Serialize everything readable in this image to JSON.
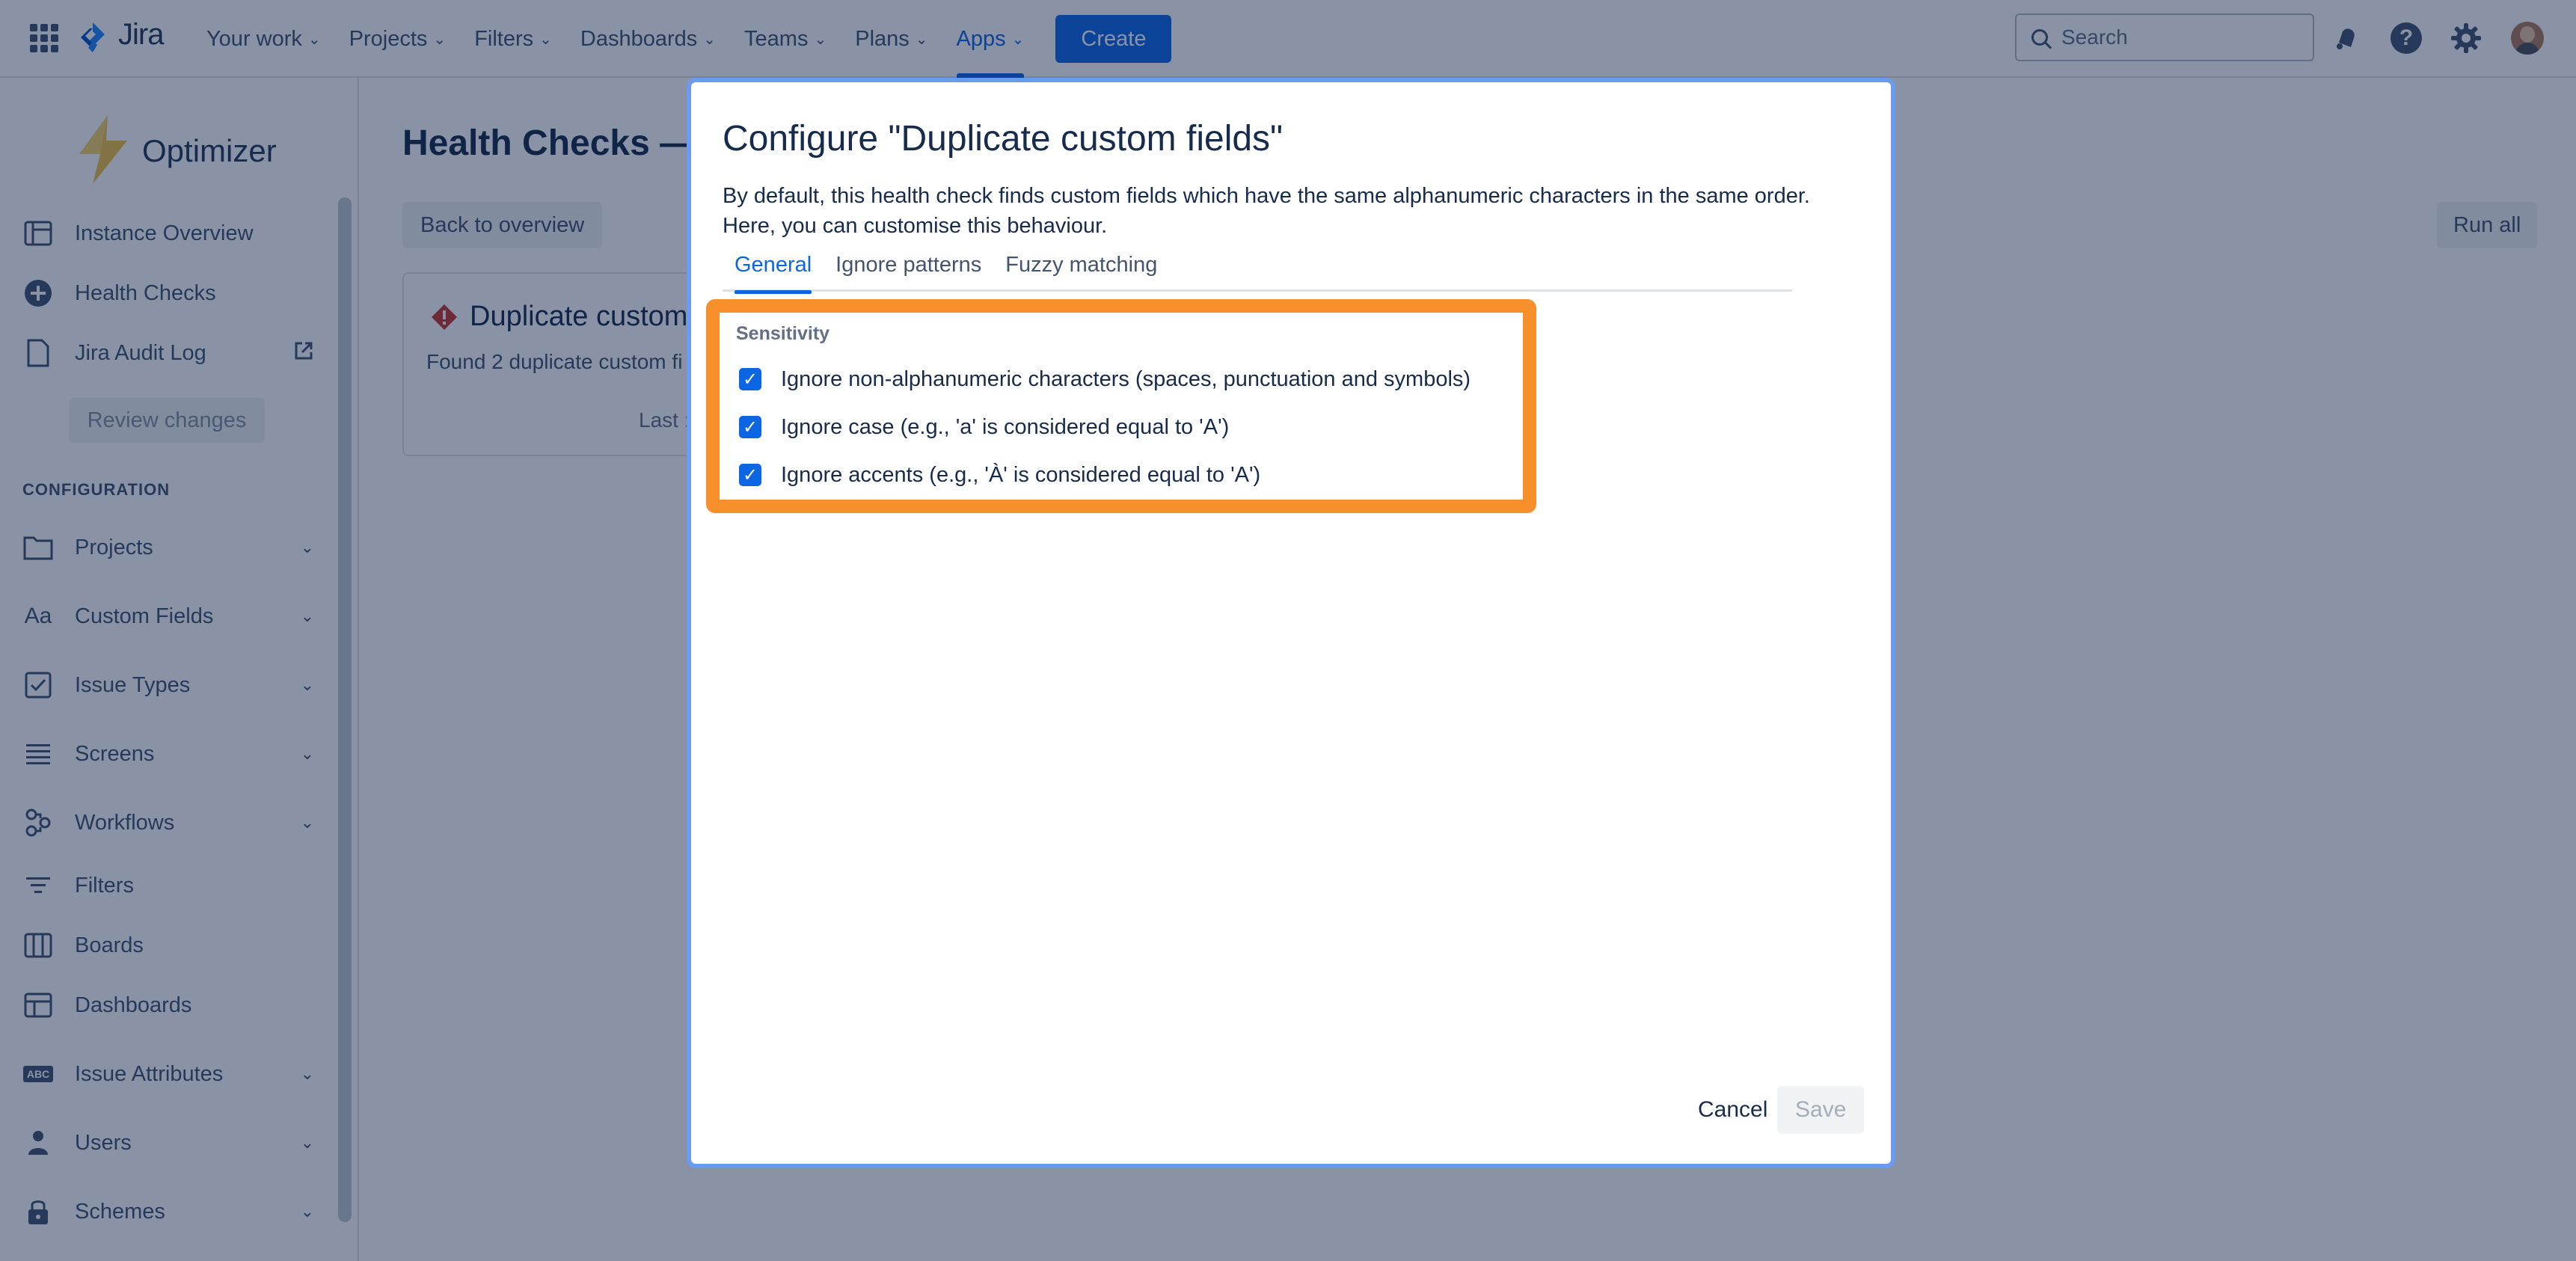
{
  "topnav": {
    "brand": "Jira",
    "items": [
      {
        "label": "Your work"
      },
      {
        "label": "Projects"
      },
      {
        "label": "Filters"
      },
      {
        "label": "Dashboards"
      },
      {
        "label": "Teams"
      },
      {
        "label": "Plans"
      },
      {
        "label": "Apps"
      }
    ],
    "active_item": "Apps",
    "create_label": "Create",
    "search_placeholder": "Search",
    "help_glyph": "?",
    "accent_color": "#0c66e4"
  },
  "sidebar": {
    "app_name": "Optimizer",
    "items": [
      {
        "label": "Instance Overview",
        "icon": "overview-icon"
      },
      {
        "label": "Health Checks",
        "icon": "plus-circle-icon"
      },
      {
        "label": "Jira Audit Log",
        "icon": "page-icon"
      }
    ],
    "review_label": "Review changes",
    "section_label": "CONFIGURATION",
    "config_items": [
      {
        "label": "Projects",
        "icon": "folder-icon"
      },
      {
        "label": "Custom Fields",
        "icon": "text-icon"
      },
      {
        "label": "Issue Types",
        "icon": "checkbox-icon"
      },
      {
        "label": "Screens",
        "icon": "list-icon"
      },
      {
        "label": "Workflows",
        "icon": "workflow-icon"
      },
      {
        "label": "Filters",
        "icon": "filter-icon"
      },
      {
        "label": "Boards",
        "icon": "board-icon"
      },
      {
        "label": "Dashboards",
        "icon": "dashboard-icon"
      },
      {
        "label": "Issue Attributes",
        "icon": "abc-icon"
      },
      {
        "label": "Users",
        "icon": "user-icon"
      },
      {
        "label": "Schemes",
        "icon": "lock-icon"
      }
    ],
    "text_icon_glyph": "Aa",
    "abc_icon_glyph": "ABC"
  },
  "main": {
    "title": "Health Checks — (",
    "back_label": "Back to overview",
    "run_all_label": "Run all",
    "card": {
      "title": "Duplicate custom",
      "description": "Found 2 duplicate custom fi",
      "last": "Last :"
    }
  },
  "modal": {
    "title": "Configure \"Duplicate custom fields\"",
    "description": "By default, this health check finds custom fields which have the same alphanumeric characters in the same order. Here, you can customise this behaviour.",
    "tabs": [
      {
        "label": "General"
      },
      {
        "label": "Ignore patterns"
      },
      {
        "label": "Fuzzy matching"
      }
    ],
    "active_tab": "General",
    "sensitivity_label": "Sensitivity",
    "options": [
      {
        "label": "Ignore non-alphanumeric characters (spaces, punctuation and symbols)",
        "checked": true
      },
      {
        "label": "Ignore case (e.g., 'a' is considered equal to 'A')",
        "checked": true
      },
      {
        "label": "Ignore accents (e.g., 'À' is considered equal to 'A')",
        "checked": true
      }
    ],
    "checkmark_glyph": "✓",
    "cancel_label": "Cancel",
    "save_label": "Save",
    "highlight_color": "#f78f2a"
  }
}
